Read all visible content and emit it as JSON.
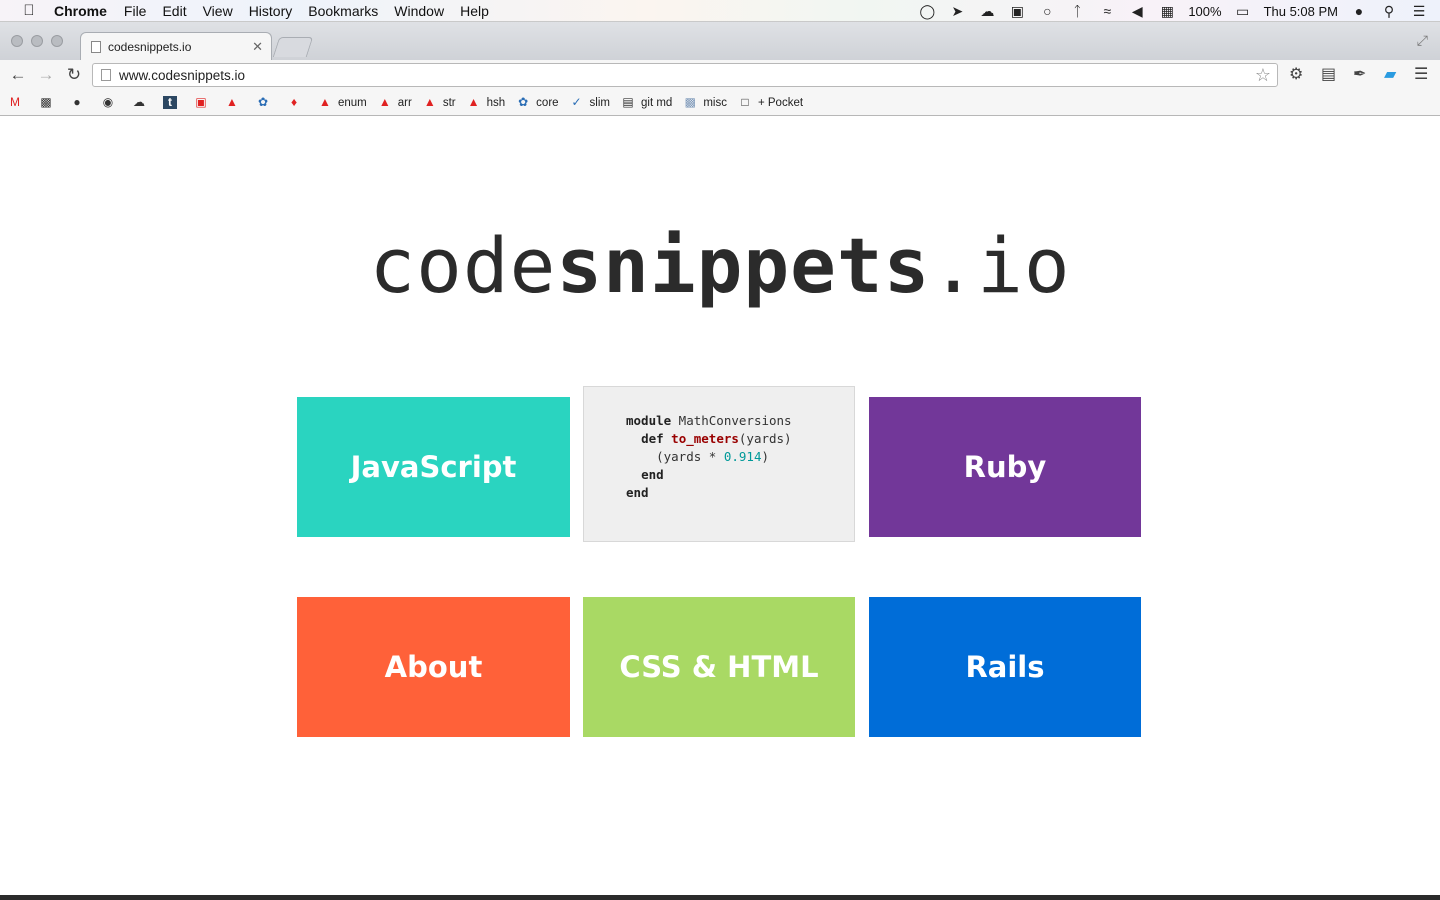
{
  "menubar": {
    "app": "Chrome",
    "items": [
      "File",
      "Edit",
      "View",
      "History",
      "Bookmarks",
      "Window",
      "Help"
    ],
    "battery": "100%",
    "clock": "Thu 5:08 PM"
  },
  "browser": {
    "tab_title": "codesnippets.io",
    "url": "www.codesnippets.io"
  },
  "bookmarks": [
    "enum",
    "arr",
    "str",
    "hsh",
    "core",
    "slim",
    "git md",
    "misc",
    "+ Pocket"
  ],
  "logo": {
    "light": "code",
    "bold": "snippets",
    "tail": ".io"
  },
  "tiles": {
    "javascript": {
      "label": "JavaScript",
      "color": "#2ad4c0"
    },
    "ruby": {
      "label": "Ruby",
      "color": "#723799"
    },
    "about": {
      "label": "About",
      "color": "#ff6139"
    },
    "css_html": {
      "label": "CSS & HTML",
      "color": "#a9d964"
    },
    "rails": {
      "label": "Rails",
      "color": "#006dd8"
    }
  },
  "code": {
    "l1_kw": "module",
    "l1_rest": " MathConversions",
    "l2_kw": "def",
    "l2_fn": "to_meters",
    "l2_rest": "(yards)",
    "l3_pre": "(yards * ",
    "l3_num": "0.914",
    "l3_post": ")",
    "l4": "end",
    "l5": "end"
  }
}
